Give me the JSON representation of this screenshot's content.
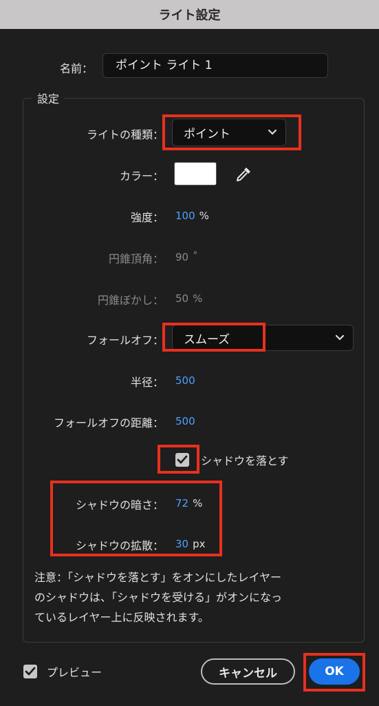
{
  "window": {
    "title": "ライト設定"
  },
  "name": {
    "label": "名前：",
    "value": "ポイント ライト 1"
  },
  "settings": {
    "legend": "設定",
    "light_type": {
      "label": "ライトの種類：",
      "value": "ポイント"
    },
    "color": {
      "label": "カラー：",
      "swatch": "#ffffff"
    },
    "intensity": {
      "label": "強度：",
      "value": "100",
      "unit": "%"
    },
    "cone_angle": {
      "label": "円錐頂角：",
      "value": "90",
      "unit": "˚"
    },
    "cone_feather": {
      "label": "円錐ぼかし：",
      "value": "50",
      "unit": "%"
    },
    "falloff": {
      "label": "フォールオフ：",
      "value": "スムーズ"
    },
    "radius": {
      "label": "半径：",
      "value": "500"
    },
    "falloff_distance": {
      "label": "フォールオフの距離：",
      "value": "500"
    },
    "casts_shadows": {
      "label": "シャドウを落とす",
      "checked": true
    },
    "shadow_darkness": {
      "label": "シャドウの暗さ：",
      "value": "72",
      "unit": "%"
    },
    "shadow_diffusion": {
      "label": "シャドウの拡散：",
      "value": "30",
      "unit": "px"
    },
    "note_lines": [
      "注意：「シャドウを落とす」をオンにしたレイヤー",
      "のシャドウは、「シャドウを受ける」がオンになっ",
      "ているレイヤー上に反映されます。"
    ]
  },
  "footer": {
    "preview": {
      "label": "プレビュー",
      "checked": true
    },
    "cancel_label": "キャンセル",
    "ok_label": "OK"
  },
  "colors": {
    "accent": "#4ea0ff",
    "ok_button": "#1a73e8",
    "highlight": "#e8301e"
  }
}
